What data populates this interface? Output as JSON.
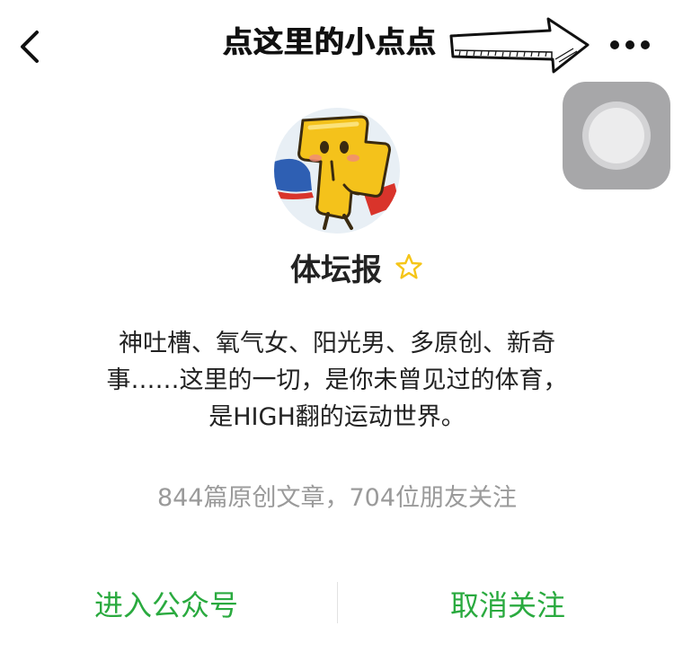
{
  "header": {
    "hint": "点这里的小点点"
  },
  "profile": {
    "name": "体坛报",
    "description_lines": [
      "神吐槽、氧气女、阳光男、多原创、新奇",
      "事……这里的一切，是你未曾见过的体育，",
      "是HIGH翻的运动世界。"
    ],
    "stats": "844篇原创文章，704位朋友关注"
  },
  "actions": {
    "enter_label": "进入公众号",
    "unfollow_label": "取消关注"
  },
  "colors": {
    "accent_green": "#2aaa3f",
    "star_gold": "#f5c518",
    "muted_text": "#9a9a9a"
  },
  "icons": {
    "back": "chevron-left-icon",
    "more": "more-dots-icon",
    "favorite": "star-outline-icon",
    "floating": "floating-ball-icon"
  }
}
